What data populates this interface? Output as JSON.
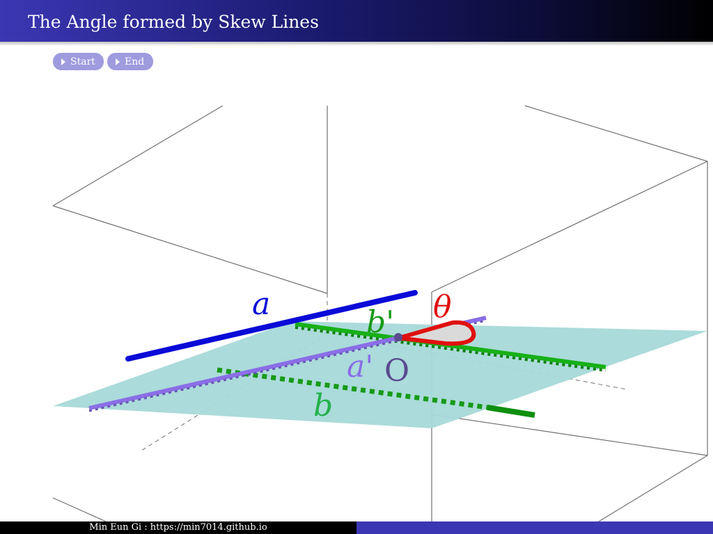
{
  "header": {
    "title": "The Angle formed by Skew Lines"
  },
  "nav": {
    "start_label": "Start",
    "end_label": "End"
  },
  "figure": {
    "labels": {
      "line_a": "a",
      "line_b": "b",
      "line_a_prime": "a'",
      "line_b_prime": "b'",
      "angle": "θ",
      "point_o": "O"
    },
    "colors": {
      "line_a": "#0a0ad8",
      "line_b": "#179a17",
      "line_a_prime": "#8a6ee6",
      "line_b_prime": "#17b017",
      "angle": "#e01010",
      "point_o": "#5a4a8e",
      "plane": "#a6d9d8",
      "box_edges": "#6e6e6e"
    }
  },
  "footer": {
    "text": "Min Eun Gi : https://min7014.github.io"
  }
}
